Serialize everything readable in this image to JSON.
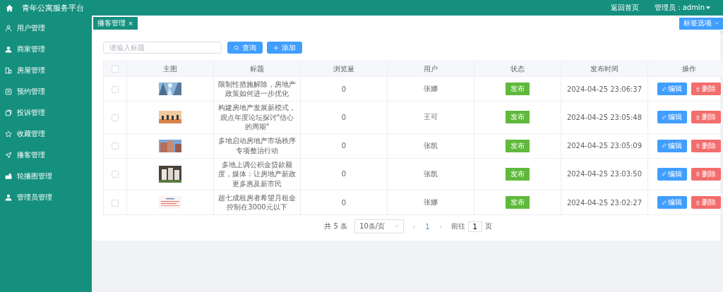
{
  "header": {
    "title": "青年公寓服务平台",
    "links": [
      {
        "label": "返回首页"
      },
      {
        "label": "管理员：admin"
      }
    ]
  },
  "sidebar": {
    "items": [
      {
        "label": "用户管理",
        "selected": false
      },
      {
        "label": "商家管理",
        "selected": false
      },
      {
        "label": "房屋管理",
        "selected": false
      },
      {
        "label": "预约管理",
        "selected": false
      },
      {
        "label": "投诉管理",
        "selected": false
      },
      {
        "label": "收藏管理",
        "selected": false
      },
      {
        "label": "播客管理",
        "selected": false
      },
      {
        "label": "轮播图管理",
        "selected": false
      },
      {
        "label": "管理员管理",
        "selected": false
      }
    ]
  },
  "tabs": [
    {
      "label": "播客管理",
      "close": "×",
      "selected": true
    }
  ],
  "tab_options": {
    "label": "标签选项"
  },
  "search": {
    "placeholder": "请输入标题"
  },
  "toolbar": [
    {
      "label": "查询",
      "kind": "search"
    },
    {
      "label": "添加",
      "kind": "add"
    }
  ],
  "table": {
    "select_all": {
      "checked": false
    },
    "columns": [
      "主图",
      "标题",
      "浏览量",
      "用户",
      "状态",
      "发布时间",
      "操作"
    ],
    "rows": [
      {
        "checked": false,
        "title": "限制性措施解除，房地产政策如何进一步优化",
        "views": "0",
        "user": "张娜",
        "status": "发布",
        "time": "2024-04-25 23:06:37",
        "actions": [
          {
            "label": "编辑",
            "kind": "edit"
          },
          {
            "label": "删除",
            "kind": "delete"
          }
        ]
      },
      {
        "checked": false,
        "title": "构建房地产发展新模式，观点年度论坛探讨\"信心的周期\"",
        "views": "0",
        "user": "王可",
        "status": "发布",
        "time": "2024-04-25 23:05:48",
        "actions": [
          {
            "label": "编辑",
            "kind": "edit"
          },
          {
            "label": "删除",
            "kind": "delete"
          }
        ]
      },
      {
        "checked": false,
        "title": "多地启动房地产市场秩序专项整治行动",
        "views": "0",
        "user": "张凯",
        "status": "发布",
        "time": "2024-04-25 23:05:09",
        "actions": [
          {
            "label": "编辑",
            "kind": "edit"
          },
          {
            "label": "删除",
            "kind": "delete"
          }
        ]
      },
      {
        "checked": false,
        "title": "多地上调公积金贷款额度，媒体：让房地产新政更多惠及新市民",
        "views": "0",
        "user": "张凯",
        "status": "发布",
        "time": "2024-04-25 23:03:50",
        "actions": [
          {
            "label": "编辑",
            "kind": "edit"
          },
          {
            "label": "删除",
            "kind": "delete"
          }
        ]
      },
      {
        "checked": false,
        "title": "超七成租房者希望月租金控制在3000元以下",
        "views": "0",
        "user": "张娜",
        "status": "发布",
        "time": "2024-04-25 23:02:27",
        "actions": [
          {
            "label": "编辑",
            "kind": "edit"
          },
          {
            "label": "删除",
            "kind": "delete"
          }
        ]
      }
    ]
  },
  "pagination": {
    "total": "共 5 条",
    "page_size": "10条/页",
    "prev": "‹",
    "pages": [
      {
        "label": "1",
        "selected": true
      }
    ],
    "next": "›",
    "goto_label": "前往",
    "goto_value": "1",
    "goto_suffix": "页"
  }
}
